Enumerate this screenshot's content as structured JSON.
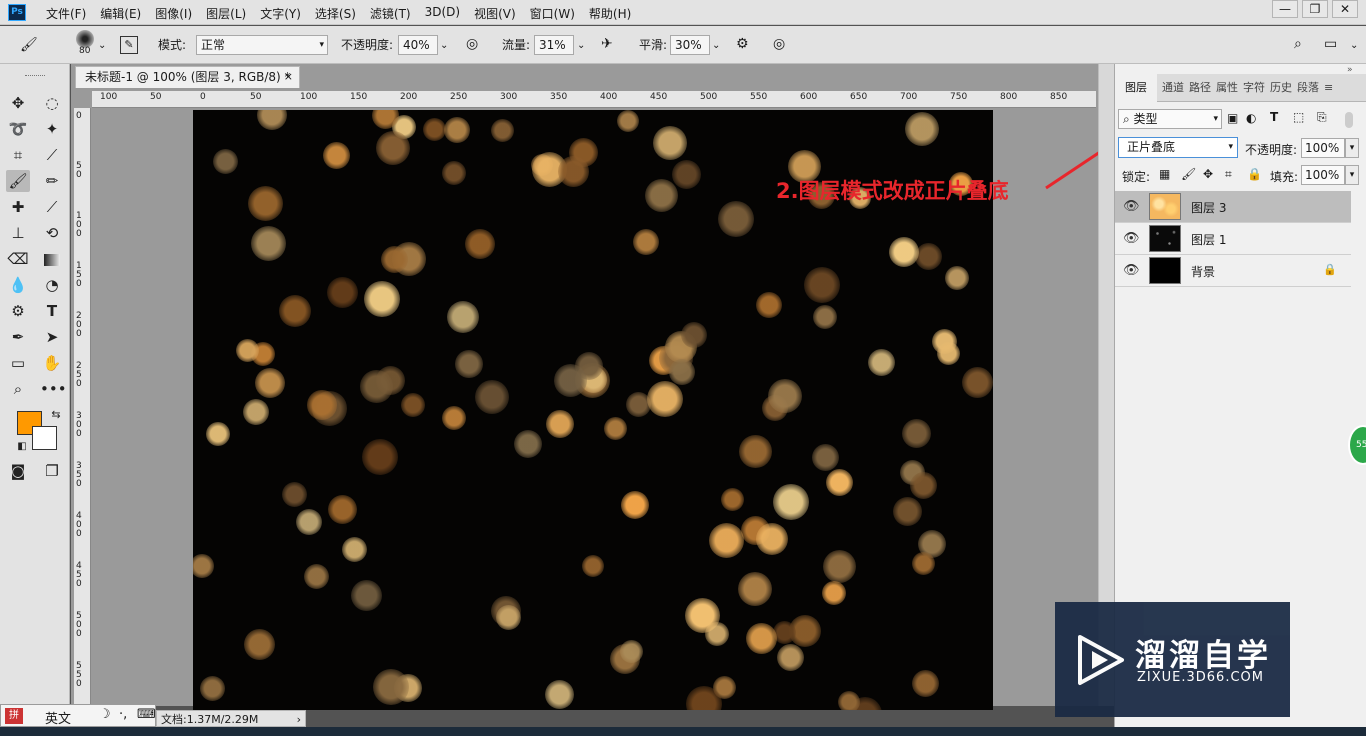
{
  "app": {
    "logo_text": "Ps"
  },
  "menubar": {
    "items": [
      "文件(F)",
      "编辑(E)",
      "图像(I)",
      "图层(L)",
      "文字(Y)",
      "选择(S)",
      "滤镜(T)",
      "3D(D)",
      "视图(V)",
      "窗口(W)",
      "帮助(H)"
    ],
    "window_buttons": [
      "—",
      "❐",
      "✕"
    ]
  },
  "options": {
    "brush_size": "80",
    "mode_label": "模式:",
    "mode_value": "正常",
    "opacity_label": "不透明度:",
    "opacity_value": "40%",
    "flow_label": "流量:",
    "flow_value": "31%",
    "smooth_label": "平滑:",
    "smooth_value": "30%"
  },
  "document": {
    "tab_title": "未标题-1 @ 100% (图层 3, RGB/8) *",
    "close": "×",
    "ruler_h": [
      "100",
      "50",
      "0",
      "50",
      "100",
      "150",
      "200",
      "250",
      "300",
      "350",
      "400",
      "450",
      "500",
      "550",
      "600",
      "650",
      "700",
      "750",
      "800",
      "850"
    ],
    "ruler_v": [
      "0",
      "5 0",
      "1 0 0",
      "1 5 0",
      "2 0 0",
      "2 5 0",
      "3 0 0",
      "3 5 0",
      "4 0 0",
      "4 5 0",
      "5 0 0",
      "5 5 0"
    ]
  },
  "annotation": {
    "text": "2.图层模式改成正片叠底",
    "color": "#e8262c"
  },
  "colors": {
    "foreground": "#ff9900",
    "background": "#ffffff",
    "canvas": "#050403"
  },
  "layers_panel": {
    "tabs": [
      "图层",
      "通道",
      "路径",
      "属性",
      "字符",
      "历史",
      "段落"
    ],
    "filter_label": "类型",
    "blend_mode": "正片叠底",
    "opacity_label": "不透明度:",
    "opacity_value": "100%",
    "lock_label": "锁定:",
    "fill_label": "填充:",
    "fill_value": "100%",
    "layers": [
      {
        "name": "图层 3",
        "selected": true,
        "visible": true,
        "locked": false
      },
      {
        "name": "图层 1",
        "selected": false,
        "visible": true,
        "locked": false
      },
      {
        "name": "背景",
        "selected": false,
        "visible": true,
        "locked": true
      }
    ]
  },
  "watermark": {
    "title": "溜溜自学",
    "url": "ZIXUE.3D66.COM"
  },
  "status": {
    "doc_info": "文档:1.37M/2.29M"
  },
  "ime": {
    "mode": "英文"
  },
  "badge": {
    "value": "55"
  }
}
